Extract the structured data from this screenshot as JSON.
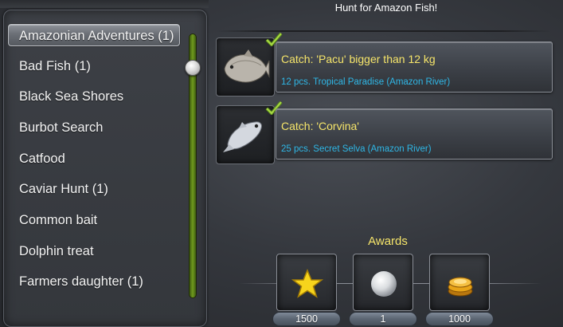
{
  "header": {
    "title": "Hunt for Amazon Fish!"
  },
  "quests": [
    {
      "label": "Amazonian Adventures (1)",
      "selected": true
    },
    {
      "label": "Bad Fish (1)"
    },
    {
      "label": "Black Sea Shores"
    },
    {
      "label": "Burbot Search"
    },
    {
      "label": "Catfood"
    },
    {
      "label": "Caviar Hunt (1)"
    },
    {
      "label": "Common bait"
    },
    {
      "label": "Dolphin treat"
    },
    {
      "label": "Farmers daughter (1)"
    }
  ],
  "tasks": [
    {
      "title": "Catch: 'Pacu' bigger than 12 kg",
      "detail": "12 pcs. Tropical Paradise (Amazon River)",
      "completed": true,
      "icon": "pacu-fish-icon"
    },
    {
      "title": "Catch: 'Corvina'",
      "detail": "25 pcs. Secret Selva (Amazon River)",
      "completed": true,
      "icon": "corvina-fish-icon"
    }
  ],
  "awards": {
    "title": "Awards",
    "items": [
      {
        "icon": "star-icon",
        "value": "1500",
        "color": "#f7d41c"
      },
      {
        "icon": "pearl-icon",
        "value": "1",
        "color": "#e8e8e8"
      },
      {
        "icon": "coins-icon",
        "value": "1000",
        "color": "#e8a418"
      }
    ]
  },
  "colors": {
    "accent_yellow": "#f6e56a",
    "accent_blue": "#2fb7e6",
    "scrollbar_green": "#6f9a1e"
  }
}
